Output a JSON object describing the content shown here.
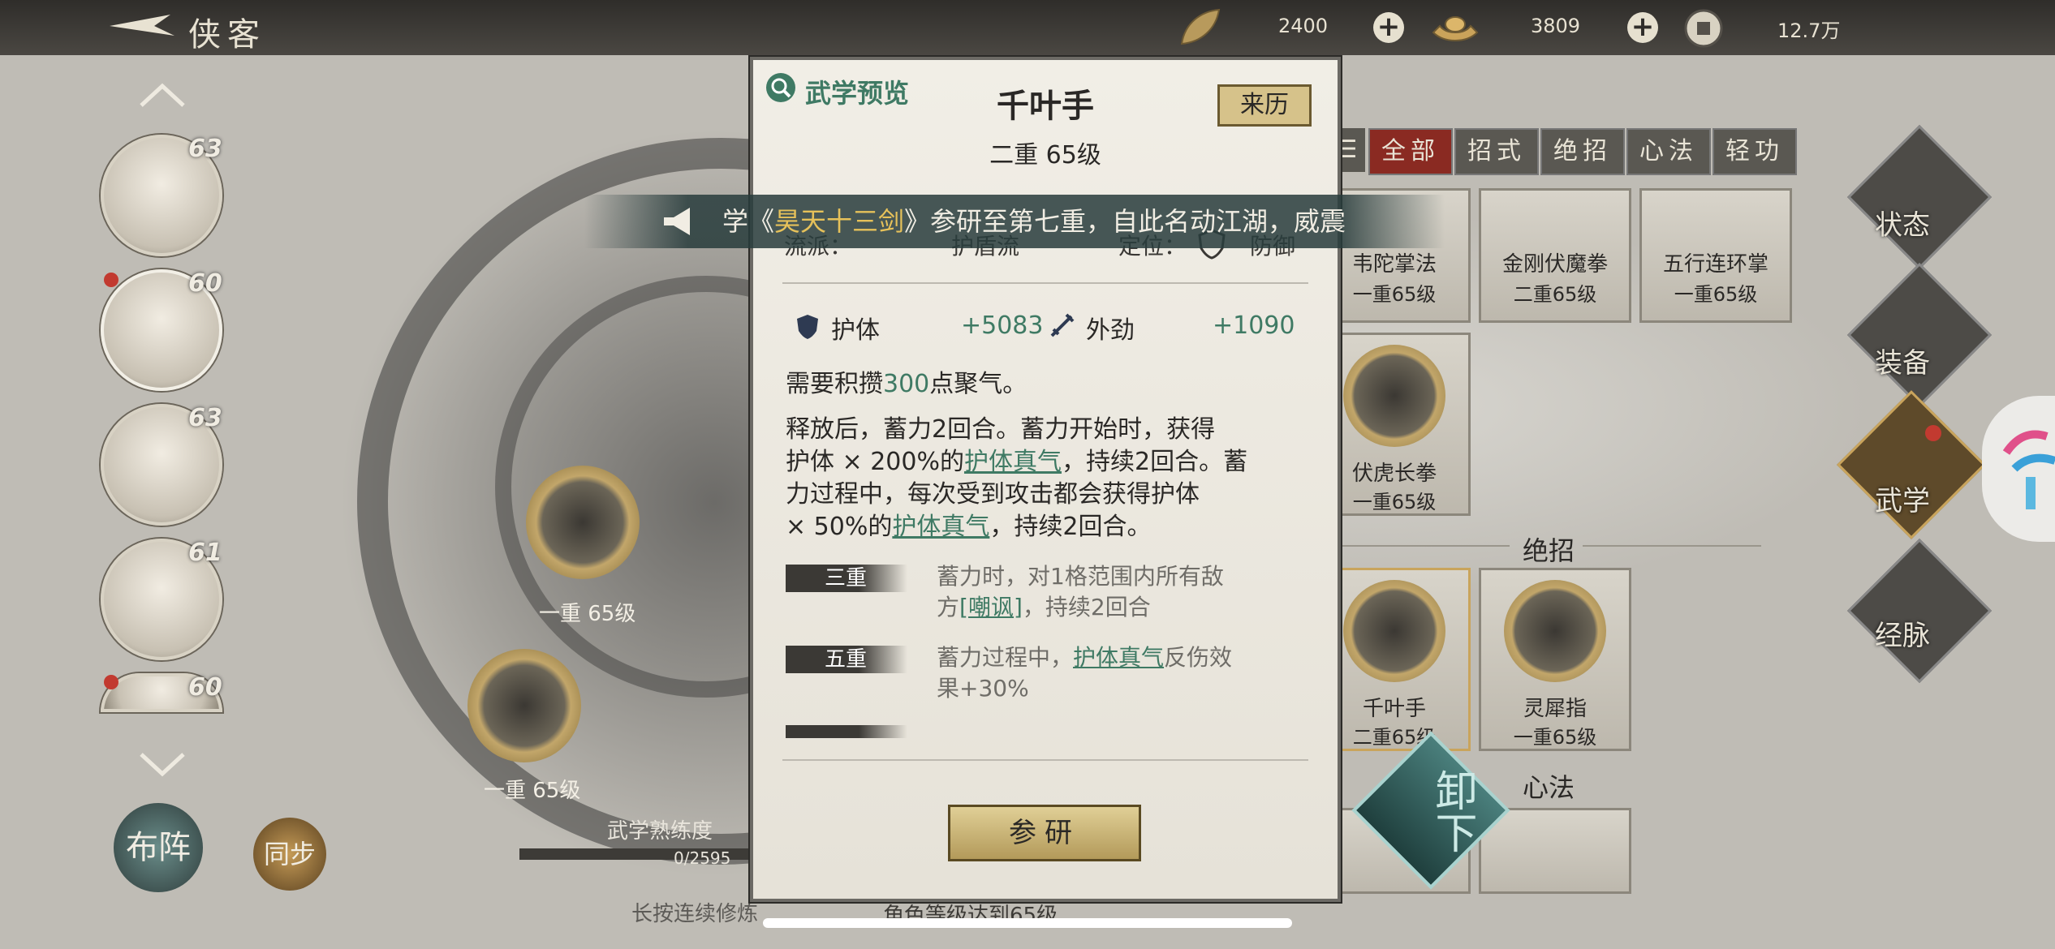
{
  "topbar": {
    "title": "侠客",
    "currency1": "2400",
    "currency2": "3809",
    "currency3": "12.7万"
  },
  "portraits": [
    {
      "level": "63"
    },
    {
      "level": "60"
    },
    {
      "level": "63"
    },
    {
      "level": "61"
    },
    {
      "level": "60"
    }
  ],
  "left_bottom": {
    "buzhen": "布阵",
    "tongbu": "同步",
    "proficiency_label": "武学熟练度",
    "proficiency_value": "0/2595",
    "hint": "长按连续修炼",
    "skill_node_1": "一重 65级",
    "skill_node_2": "一重 65级",
    "bottom_req": "角色等级达到65级"
  },
  "tabs": [
    "全部",
    "招式",
    "绝招",
    "心法",
    "轻功"
  ],
  "right_cards": [
    {
      "name": "韦陀掌法",
      "level": "一重65级"
    },
    {
      "name": "金刚伏魔拳",
      "level": "二重65级"
    },
    {
      "name": "五行连环掌",
      "level": "一重65级"
    },
    {
      "name": "伏虎长拳",
      "level": "一重65级"
    },
    {
      "name": "千叶手",
      "level": "二重65级"
    },
    {
      "name": "灵犀指",
      "level": "一重65级"
    }
  ],
  "right_sections": {
    "juezhao": "绝招",
    "xinfa": "心法"
  },
  "side_nav": [
    "状态",
    "装备",
    "武学",
    "经脉"
  ],
  "unload": "卸下",
  "banner": {
    "pre": "学《",
    "name": "昊天十三剑",
    "post": "》参研至第七重，自此名动江湖，威震"
  },
  "modal": {
    "preview_label": "武学预览",
    "skill_name": "千叶手",
    "origin_button": "来历",
    "tier": "二重 65级",
    "sect_label": "流派：",
    "sect_value": "护盾流",
    "role_label": "定位：",
    "role_value": "防御",
    "stat1_name": "护体",
    "stat1_value": "+5083",
    "stat2_name": "外劲",
    "stat2_value": "+1090",
    "req_pre": "需要积攒",
    "req_num": "300",
    "req_post": "点聚气。",
    "desc_1": "释放后，蓄力2回合。蓄力开始时，获得",
    "desc_2a": "护体 × 200%的",
    "desc_2b": "护体真气",
    "desc_2c": "，持续2回合。蓄",
    "desc_3": "力过程中，每次受到攻击都会获得护体",
    "desc_4a": "× 50%的",
    "desc_4b": "护体真气",
    "desc_4c": "，持续2回合。",
    "rank3_label": "三重",
    "rank3_text_1": "蓄力时，对1格范围内所有敌",
    "rank3_text_2a": "方",
    "rank3_text_2b": "[嘲讽]",
    "rank3_text_2c": "，持续2回合",
    "rank5_label": "五重",
    "rank5_text_1a": "蓄力过程中，",
    "rank5_text_1b": "护体真气",
    "rank5_text_1c": "反伤效",
    "rank5_text_2": "果+30%",
    "study_button": "参研"
  }
}
